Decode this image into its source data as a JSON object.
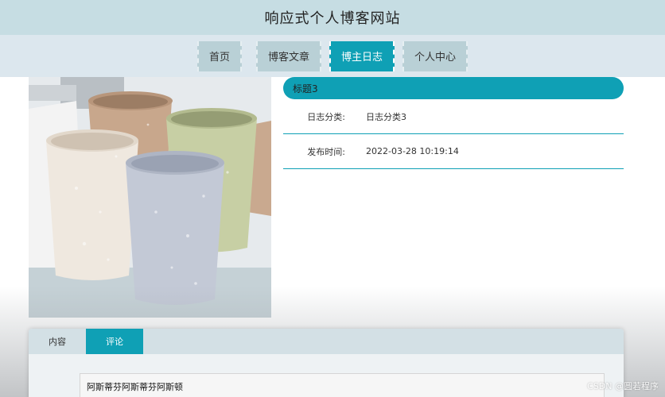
{
  "site": {
    "title": "响应式个人博客网站"
  },
  "nav": {
    "items": [
      {
        "label": "首页"
      },
      {
        "label": "博客文章"
      },
      {
        "label": "博主日志"
      },
      {
        "label": "个人中心"
      }
    ],
    "active_index": 2
  },
  "detail": {
    "title": "标题3",
    "category_label": "日志分类:",
    "category_value": "日志分类3",
    "time_label": "发布时间:",
    "time_value": "2022-03-28 10:19:14"
  },
  "tabs": {
    "items": [
      {
        "label": "内容"
      },
      {
        "label": "评论"
      }
    ],
    "active_index": 1
  },
  "comment": {
    "value": "阿斯蒂芬阿斯蒂芬阿斯顿"
  },
  "watermark": {
    "text": "CSDN @圆若程序"
  },
  "colors": {
    "accent": "#0fa0b5",
    "header": "#c6dde3",
    "nav": "#dce7ee"
  }
}
